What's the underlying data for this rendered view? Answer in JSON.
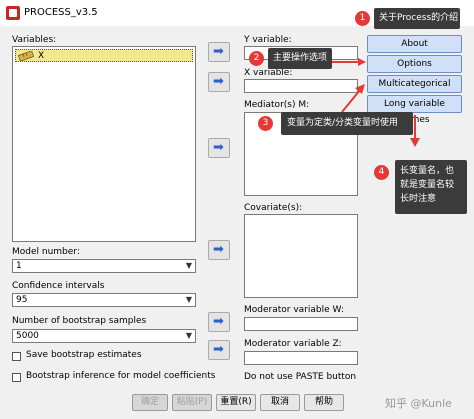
{
  "window": {
    "title": "PROCESS_v3.5"
  },
  "variables": {
    "label": "Variables:",
    "items": [
      {
        "name": "X"
      }
    ]
  },
  "fields": {
    "y_variable_label": "Y variable:",
    "x_variable_label": "X variable:",
    "mediators_label": "Mediator(s) M:",
    "covariates_label": "Covariate(s):",
    "moderator_w_label": "Moderator variable W:",
    "moderator_z_label": "Moderator variable Z:",
    "paste_note": "Do not use PASTE button"
  },
  "side_buttons": {
    "about": "About",
    "options": "Options",
    "multicategorical": "Multicategorical",
    "long_names": "Long variable names"
  },
  "settings": {
    "model_number_label": "Model number:",
    "model_number_value": "1",
    "confidence_label": "Confidence intervals",
    "confidence_value": "95",
    "bootstrap_label": "Number of bootstrap samples",
    "bootstrap_value": "5000",
    "save_bootstrap_label": "Save bootstrap estimates",
    "bootstrap_inference_label": "Bootstrap inference for model coefficients"
  },
  "bottom_buttons": {
    "ok": "确定",
    "paste": "粘贴(P)",
    "reset": "重置(R)",
    "cancel": "取消",
    "help": "帮助"
  },
  "annotations": [
    {
      "number": "1",
      "text": "关于Process的介绍"
    },
    {
      "number": "2",
      "text": "主要操作选项"
    },
    {
      "number": "3",
      "text": "变量为定类/分类变量时使用"
    },
    {
      "number": "4",
      "text": "长变量名，也就是变量名较长时注意"
    }
  ],
  "watermark": "知乎 @Kunle",
  "colors": {
    "accent": "#2a62c9",
    "annotation_red": "#e53935",
    "side_button": "#cfe0f7",
    "variable_highlight": "#f4e88e"
  },
  "icons": {
    "arrow": "arrow-right-icon",
    "ruler": "ruler-icon"
  }
}
